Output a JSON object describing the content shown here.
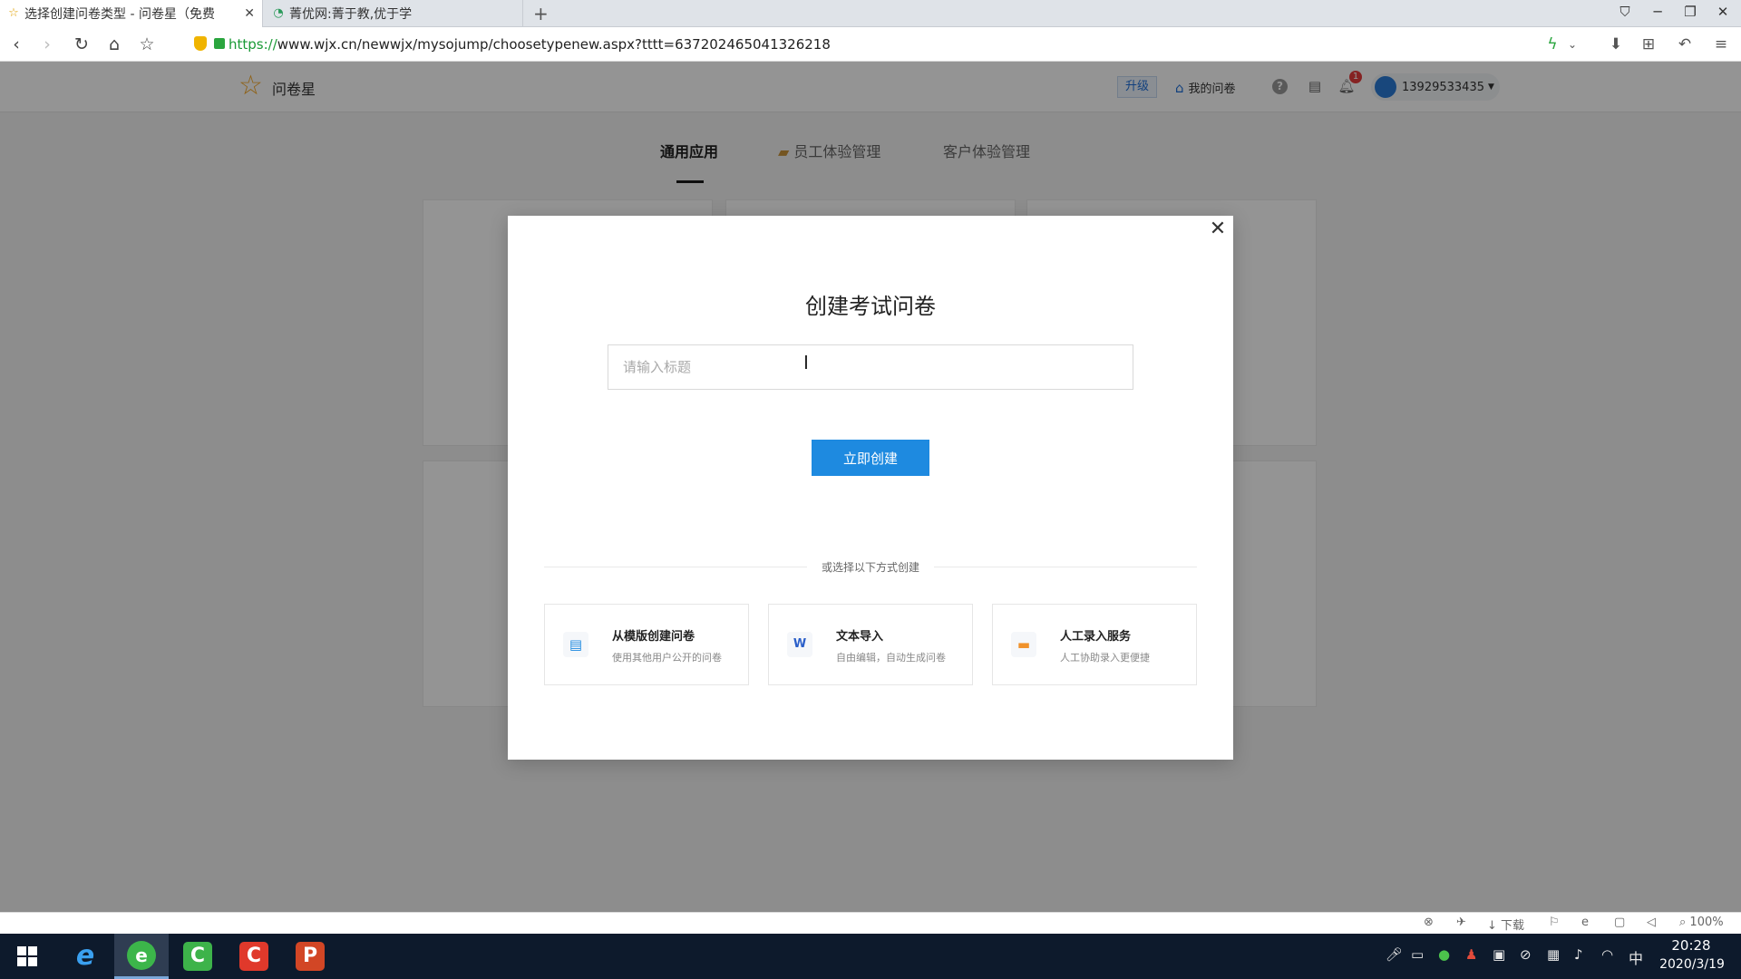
{
  "browser": {
    "tabs": [
      {
        "title": "选择创建问卷类型 - 问卷星（免费",
        "icon": "star-icon"
      },
      {
        "title": "菁优网:菁于教,优于学",
        "icon": "jyeoo-icon"
      }
    ],
    "new_tab": "+",
    "url_scheme": "https://",
    "url_rest": "www.wjx.cn/newwjx/mysojump/choosetypenew.aspx?tttt=637202465041326218"
  },
  "site": {
    "logo_text": "问卷星",
    "upgrade": "升级",
    "my_survey": "我的问卷",
    "notification_count": "1",
    "username": "13929533435"
  },
  "nav_tabs": [
    {
      "label": "通用应用",
      "active": true
    },
    {
      "label": "员工体验管理",
      "active": false
    },
    {
      "label": "客户体验管理",
      "active": false
    }
  ],
  "modal": {
    "title": "创建考试问卷",
    "input_placeholder": "请输入标题",
    "create_button": "立即创建",
    "divider_text": "或选择以下方式创建",
    "options": [
      {
        "title": "从模版创建问卷",
        "desc": "使用其他用户公开的问卷",
        "icon": "document-icon",
        "color": "#1e8ae0"
      },
      {
        "title": "文本导入",
        "desc": "自由编辑，自动生成问卷",
        "icon": "word-icon",
        "color": "#2b5fc9"
      },
      {
        "title": "人工录入服务",
        "desc": "人工协助录入更便捷",
        "icon": "service-icon",
        "color": "#f0922b"
      }
    ]
  },
  "statusbar": {
    "download": "下载",
    "zoom": "100%"
  },
  "taskbar": {
    "time": "20:28",
    "date": "2020/3/19",
    "ime": "中"
  }
}
